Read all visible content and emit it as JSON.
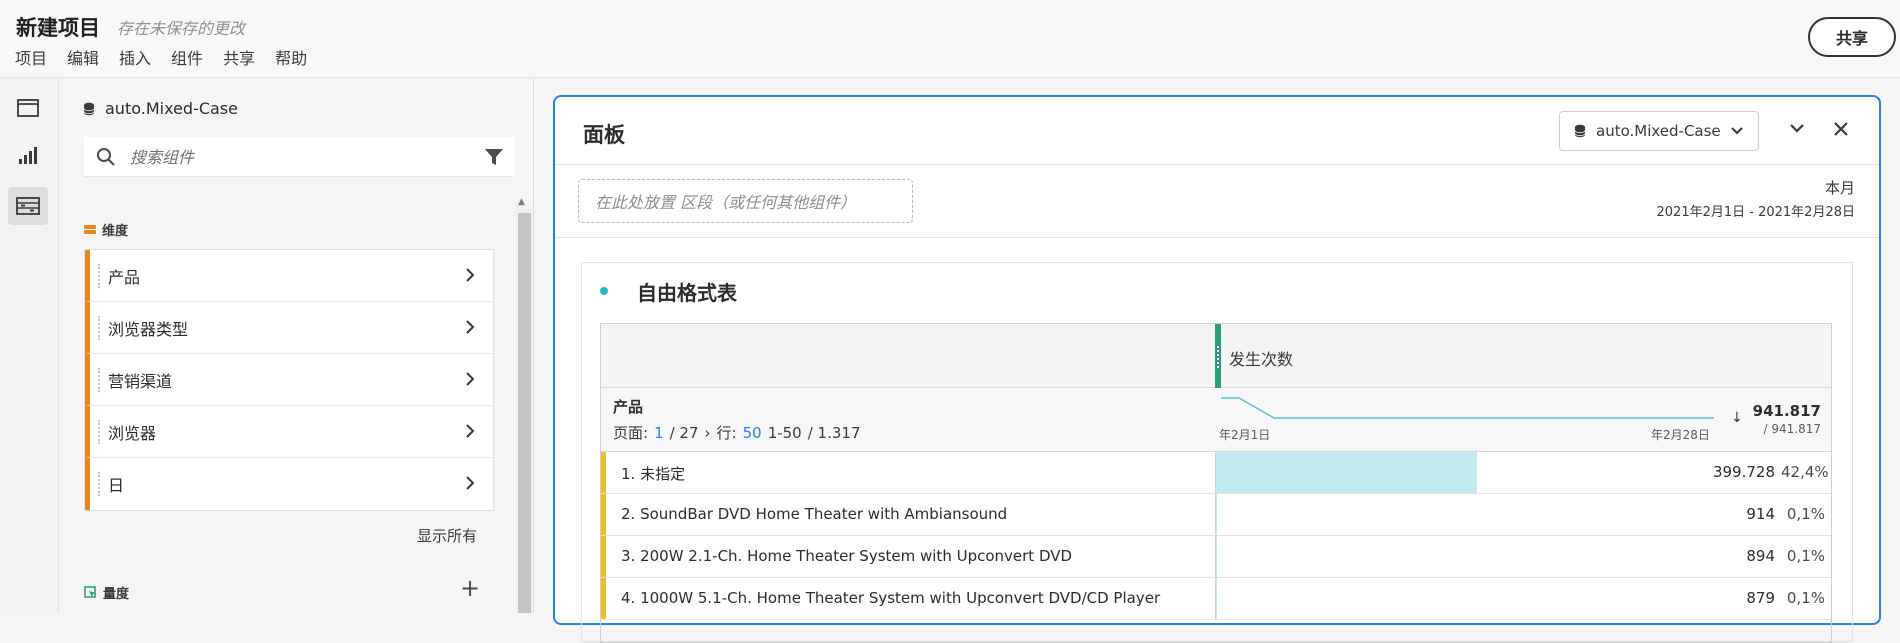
{
  "app": {
    "title": "新建项目",
    "unsaved": "存在未保存的更改",
    "share_label": "共享"
  },
  "menu": [
    "项目",
    "编辑",
    "插入",
    "组件",
    "共享",
    "帮助"
  ],
  "rail": {
    "icons": [
      "panel-icon",
      "visualization-icon",
      "components-icon"
    ]
  },
  "components": {
    "datasource": "auto.Mixed-Case",
    "search_placeholder": "搜索组件",
    "dimensions_label": "维度",
    "dimensions": [
      "产品",
      "浏览器类型",
      "营销渠道",
      "浏览器",
      "日"
    ],
    "show_all": "显示所有",
    "metrics_label": "量度"
  },
  "panel": {
    "title": "面板",
    "datasource": "auto.Mixed-Case",
    "dropzone": "在此处放置 区段（或任何其他组件）",
    "date_label": "本月",
    "date_range": "2021年2月1日 - 2021年2月28日"
  },
  "table": {
    "title": "自由格式表",
    "metric": "发生次数",
    "dimension": "产品",
    "pager": {
      "page_label": "页面:",
      "page": "1",
      "page_total": "/ 27",
      "rows_label": "行:",
      "rows": "50",
      "range": "1-50",
      "range_total": "/ 1.317"
    },
    "spark_start": "年2月1日",
    "spark_end": "年2月28日",
    "total": "941.817",
    "total_sub": "/ 941.817",
    "rows": [
      {
        "label": "1. 未指定",
        "value": "399.728",
        "pct": "42,4%",
        "share": 0.424
      },
      {
        "label": "2. SoundBar DVD Home Theater with Ambiansound",
        "value": "914",
        "pct": "0,1%",
        "share": 0.001
      },
      {
        "label": "3. 200W 2.1-Ch. Home Theater System with Upconvert DVD",
        "value": "894",
        "pct": "0,1%",
        "share": 0.001
      },
      {
        "label": "4. 1000W 5.1-Ch. Home Theater System with Upconvert DVD/CD Player",
        "value": "879",
        "pct": "0,1%",
        "share": 0.001
      }
    ]
  },
  "colors": {
    "accent": "#2680eb",
    "dimension": "#e68619",
    "row_marker": "#e8c02e",
    "bar": "#bfeaef",
    "metric_marker": "#2d9d78"
  }
}
